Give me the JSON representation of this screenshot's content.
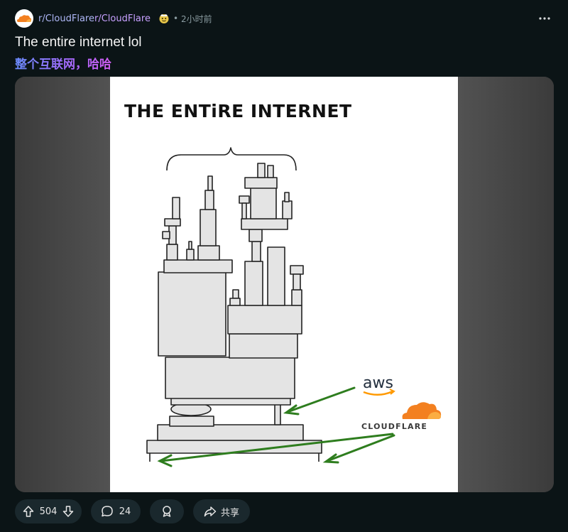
{
  "post": {
    "subreddit_prefix": "r/CloudFlare",
    "subreddit_name": "r/CloudFlare",
    "separator": "•",
    "time": "2小时前",
    "title": "The entire internet lol",
    "translated_title": "整个互联网，哈哈"
  },
  "comic": {
    "heading": "THE ENTiRE INTERNET",
    "aws_label": "aws",
    "cloudflare_label": "CLOUDFLARE"
  },
  "actions": {
    "vote_count": "504",
    "comment_count": "24",
    "share_label": "共享"
  },
  "colors": {
    "cloudflare_orange": "#f38020",
    "arrow_green": "#2e7d1e",
    "aws_orange": "#ff9900"
  },
  "icons": [
    "cloudflare-logo-icon",
    "mod-badge-icon",
    "more-options-icon",
    "upvote-icon",
    "downvote-icon",
    "comment-icon",
    "award-icon",
    "share-icon"
  ]
}
